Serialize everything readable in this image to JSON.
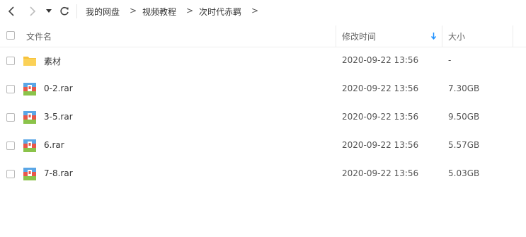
{
  "toolbar": {
    "back_icon": "chevron-left-icon",
    "forward_icon": "chevron-right-icon",
    "dropdown_icon": "caret-down-icon",
    "refresh_icon": "refresh-icon"
  },
  "breadcrumb": {
    "items": [
      "我的网盘",
      "视频教程",
      "次时代赤羁"
    ],
    "separator": ">"
  },
  "table": {
    "columns": {
      "name": "文件名",
      "modified": "修改时间",
      "size": "大小"
    },
    "sort_icon": "sort-down-arrow-icon",
    "rows": [
      {
        "name": "素材",
        "type": "folder",
        "modified": "2020-09-22 13:56",
        "size": "-"
      },
      {
        "name": "0-2.rar",
        "type": "rar",
        "modified": "2020-09-22 13:56",
        "size": "7.30GB"
      },
      {
        "name": "3-5.rar",
        "type": "rar",
        "modified": "2020-09-22 13:56",
        "size": "9.50GB"
      },
      {
        "name": "6.rar",
        "type": "rar",
        "modified": "2020-09-22 13:56",
        "size": "5.57GB"
      },
      {
        "name": "7-8.rar",
        "type": "rar",
        "modified": "2020-09-22 13:56",
        "size": "5.03GB"
      }
    ]
  },
  "colors": {
    "accent": "#1e90ff",
    "folder": "#f7c23b",
    "archive_top": "#5aa6e6",
    "archive_mid": "#e8574a",
    "archive_bottom": "#8bc34a"
  }
}
